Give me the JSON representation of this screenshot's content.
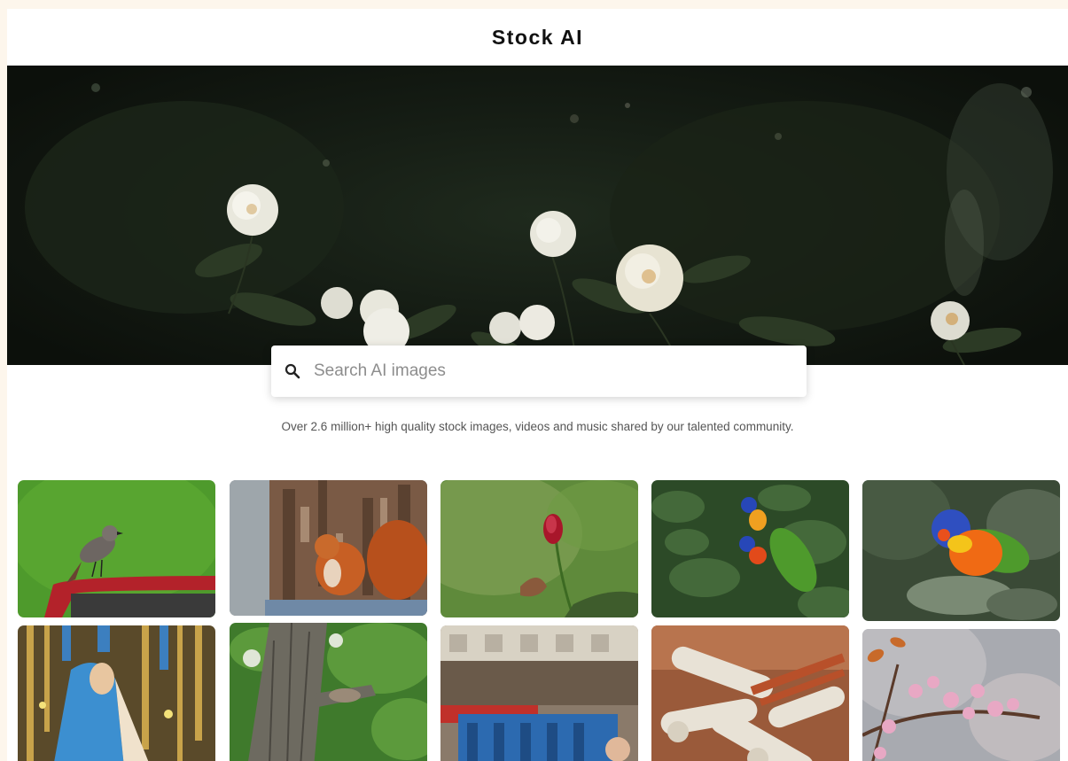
{
  "header": {
    "title": "Stock AI"
  },
  "hero": {
    "image_icon": "white-roses-photo"
  },
  "search": {
    "placeholder": "Search AI images",
    "value": "",
    "icon": "search-icon"
  },
  "tagline": "Over 2.6 million+ high quality stock images, videos and music shared by our talented community.",
  "gallery": {
    "items": [
      {
        "subject": "bird-on-red-rail"
      },
      {
        "subject": "red-squirrel-on-tree"
      },
      {
        "subject": "rose-bud"
      },
      {
        "subject": "lorikeets-in-leaves"
      },
      {
        "subject": "rainbow-lorikeet"
      },
      {
        "subject": "ornate-statue"
      },
      {
        "subject": "squirrel-in-tree"
      },
      {
        "subject": "crowd-in-stadium"
      },
      {
        "subject": "rolled-papers"
      },
      {
        "subject": "cherry-blossoms"
      }
    ]
  },
  "colors": {
    "page_background": "#fdf6ec",
    "content_background": "#ffffff",
    "hero_dark": "#141b13"
  }
}
